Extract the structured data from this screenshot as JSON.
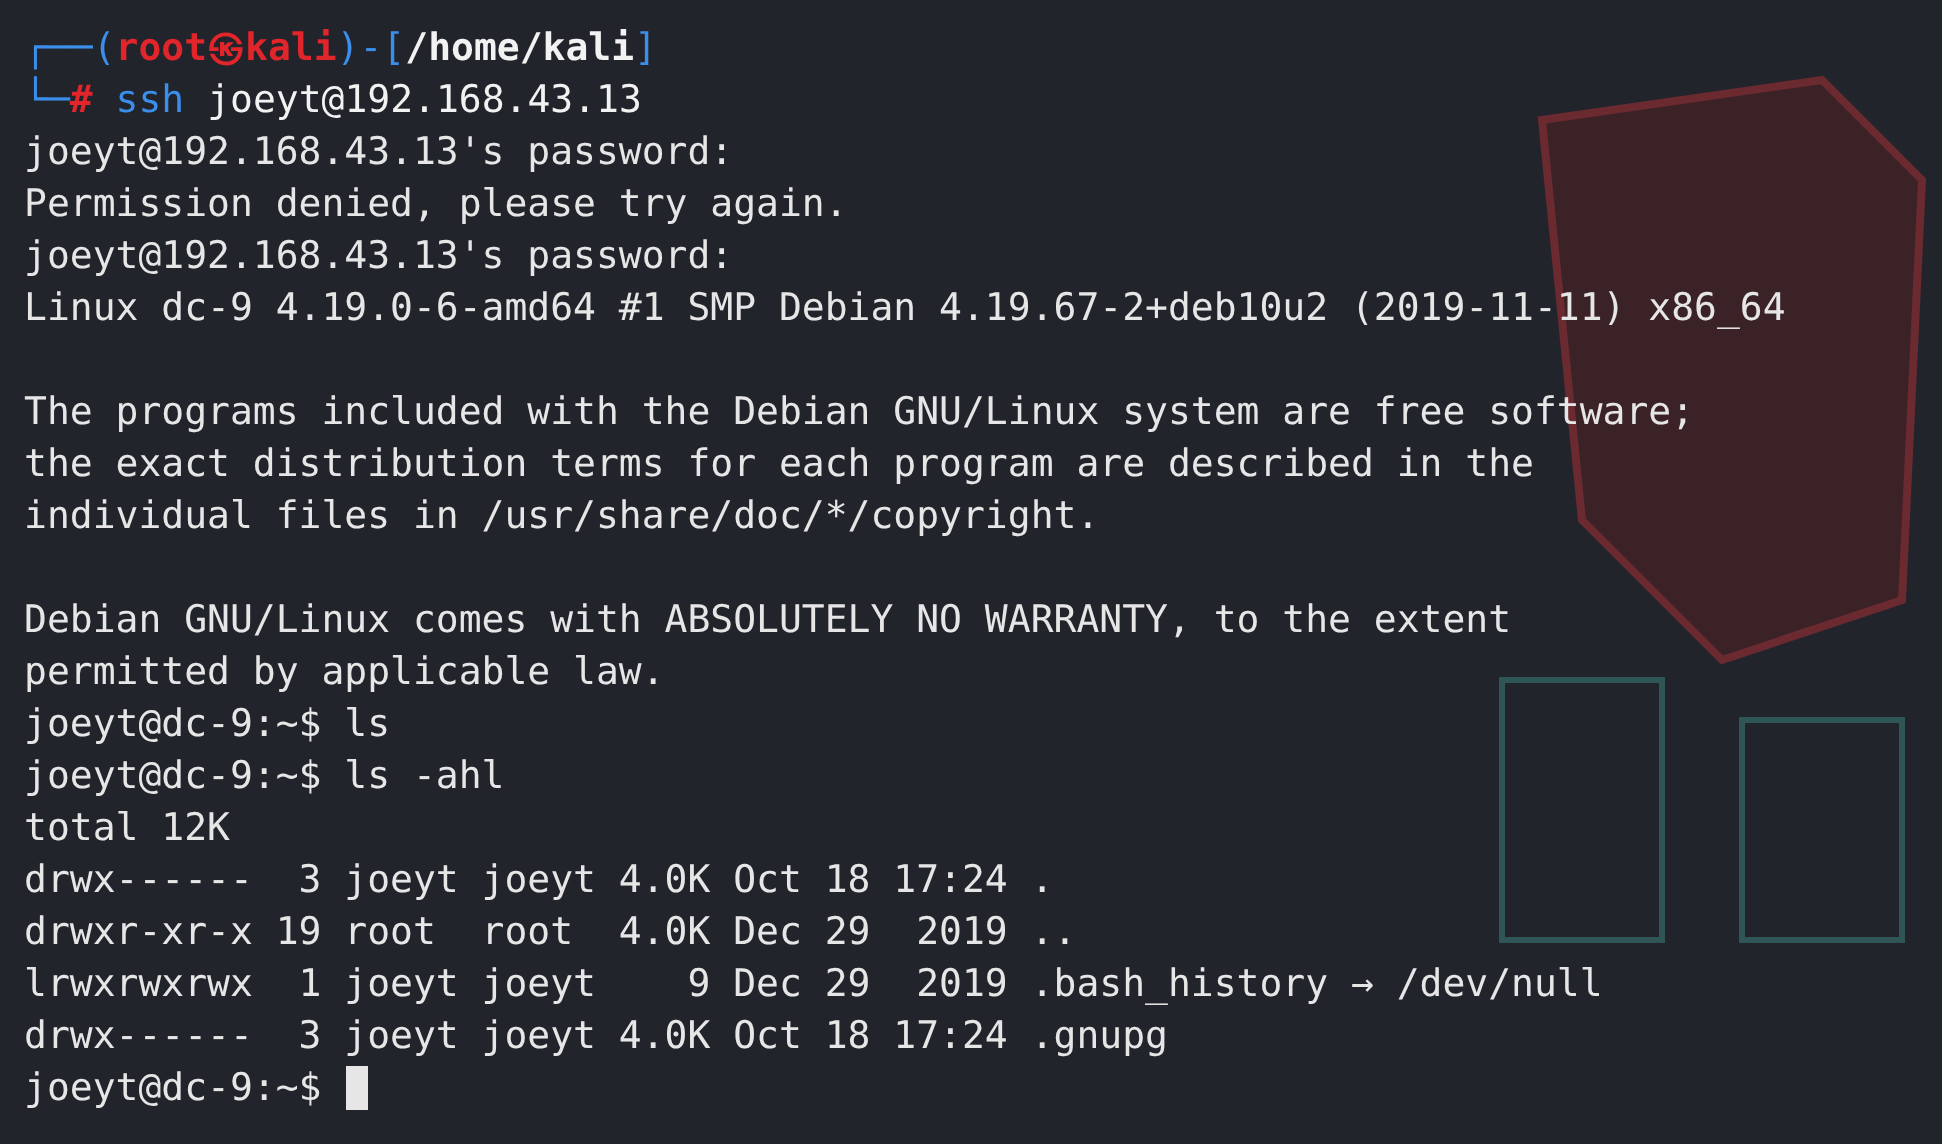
{
  "prompt": {
    "corner_top": "┌──(",
    "user": "root",
    "symbol": "㉿",
    "host": "kali",
    "mid": ")-[",
    "path": "/home/kali",
    "close": "]",
    "corner_bottom": "└─",
    "sign": "#",
    "command": "ssh",
    "args": "joeyt@192.168.43.13"
  },
  "lines": [
    {
      "kind": "text",
      "text": "joeyt@192.168.43.13's password:"
    },
    {
      "kind": "text",
      "text": "Permission denied, please try again."
    },
    {
      "kind": "text",
      "text": "joeyt@192.168.43.13's password:"
    },
    {
      "kind": "text",
      "text": "Linux dc-9 4.19.0-6-amd64 #1 SMP Debian 4.19.67-2+deb10u2 (2019-11-11) x86_64"
    },
    {
      "kind": "gap"
    },
    {
      "kind": "text",
      "text": "The programs included with the Debian GNU/Linux system are free software;"
    },
    {
      "kind": "text",
      "text": "the exact distribution terms for each program are described in the"
    },
    {
      "kind": "text",
      "text": "individual files in /usr/share/doc/*/copyright."
    },
    {
      "kind": "gap"
    },
    {
      "kind": "text",
      "text": "Debian GNU/Linux comes with ABSOLUTELY NO WARRANTY, to the extent"
    },
    {
      "kind": "text",
      "text": "permitted by applicable law."
    },
    {
      "kind": "text",
      "text": "joeyt@dc-9:~$ ls"
    },
    {
      "kind": "text",
      "text": "joeyt@dc-9:~$ ls -ahl"
    },
    {
      "kind": "text",
      "text": "total 12K"
    },
    {
      "kind": "text",
      "text": "drwx------  3 joeyt joeyt 4.0K Oct 18 17:24 ."
    },
    {
      "kind": "text",
      "text": "drwxr-xr-x 19 root  root  4.0K Dec 29  2019 .."
    },
    {
      "kind": "text",
      "text": "lrwxrwxrwx  1 joeyt joeyt    9 Dec 29  2019 .bash_history → /dev/null"
    },
    {
      "kind": "text",
      "text": "drwx------  3 joeyt joeyt 4.0K Oct 18 17:24 .gnupg"
    },
    {
      "kind": "cursor",
      "text": "joeyt@dc-9:~$"
    }
  ]
}
